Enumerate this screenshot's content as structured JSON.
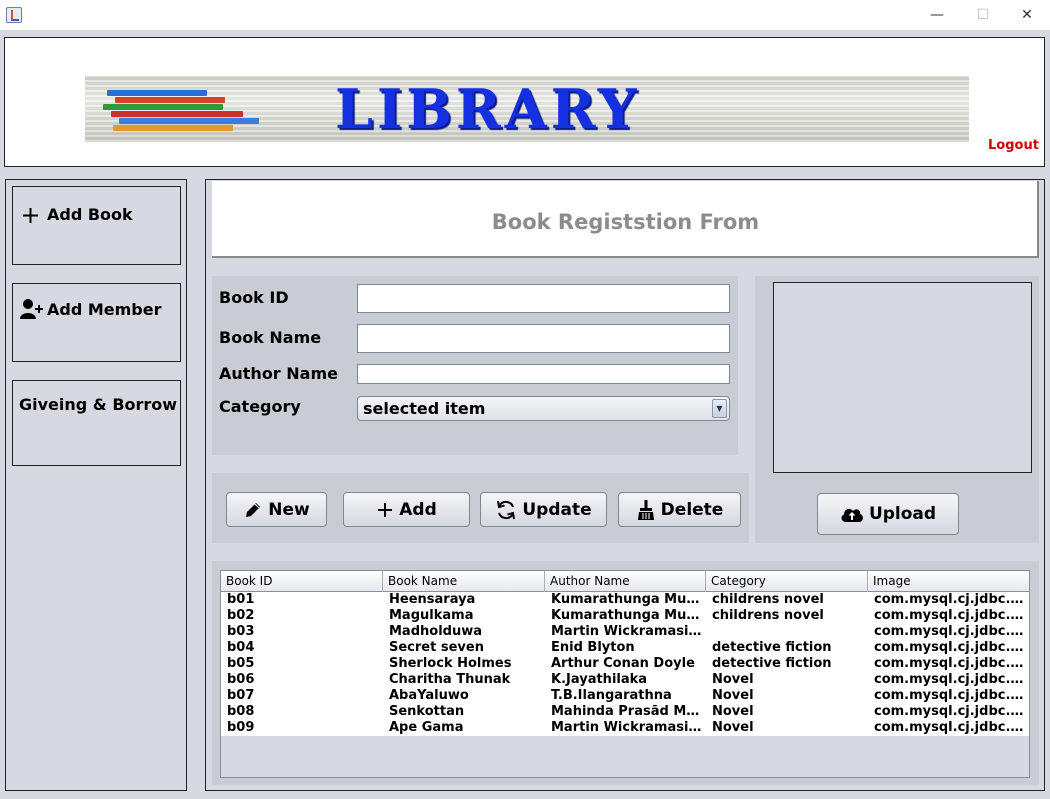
{
  "window": {
    "icon": "java-cup-icon",
    "controls": [
      "minimize",
      "maximize",
      "close"
    ]
  },
  "header": {
    "banner_text": "LIBRARY",
    "logout_label": "Logout"
  },
  "sidebar": {
    "items": [
      {
        "label": "Add Book",
        "icon": "plus-icon"
      },
      {
        "label": "Add Member",
        "icon": "add-user-icon"
      },
      {
        "label": "Giveing & Borrow",
        "icon": ""
      }
    ]
  },
  "form": {
    "title": "Book Registstion From",
    "fields": {
      "book_id": {
        "label": "Book  ID",
        "value": ""
      },
      "book_name": {
        "label": "Book Name",
        "value": ""
      },
      "author_name": {
        "label": "Author Name",
        "value": ""
      },
      "category": {
        "label": "Category",
        "selected": "selected item"
      }
    }
  },
  "buttons": {
    "new": {
      "label": "New",
      "icon": "pencil-icon"
    },
    "add": {
      "label": "Add",
      "icon": "plus-icon"
    },
    "update": {
      "label": "Update",
      "icon": "refresh-icon"
    },
    "delete": {
      "label": "Delete",
      "icon": "broom-icon"
    },
    "upload": {
      "label": "Upload",
      "icon": "cloud-upload-icon"
    }
  },
  "table": {
    "columns": [
      "Book ID",
      "Book Name",
      "Author Name",
      "Category",
      "Image"
    ],
    "rows": [
      [
        "b01",
        "Heensaraya",
        "Kumarathunga Mun...",
        "childrens novel",
        "com.mysql.cj.jdbc.B..."
      ],
      [
        "b02",
        "Magulkama",
        "Kumarathunga Mun...",
        "childrens novel",
        "com.mysql.cj.jdbc.B..."
      ],
      [
        "b03",
        "Madholduwa",
        "Martin Wickramasin...",
        "",
        "com.mysql.cj.jdbc.B..."
      ],
      [
        "b04",
        "Secret seven",
        "Enid Blyton",
        "detective fiction",
        "com.mysql.cj.jdbc.B..."
      ],
      [
        "b05",
        "Sherlock Holmes",
        "Arthur Conan Doyle",
        "detective fiction",
        "com.mysql.cj.jdbc.B..."
      ],
      [
        "b06",
        "Charitha Thunak",
        "K.Jayathilaka",
        "Novel",
        "com.mysql.cj.jdbc.B..."
      ],
      [
        "b07",
        "AbaYaluwo",
        "T.B.Ilangarathna",
        "Novel",
        "com.mysql.cj.jdbc.B..."
      ],
      [
        "b08",
        "Senkottan",
        "Mahinda Prasād Ma...",
        "Novel",
        "com.mysql.cj.jdbc.B..."
      ],
      [
        "b09",
        "Ape Gama",
        "Martin Wickramasin...",
        "Novel",
        "com.mysql.cj.jdbc.B..."
      ]
    ]
  }
}
